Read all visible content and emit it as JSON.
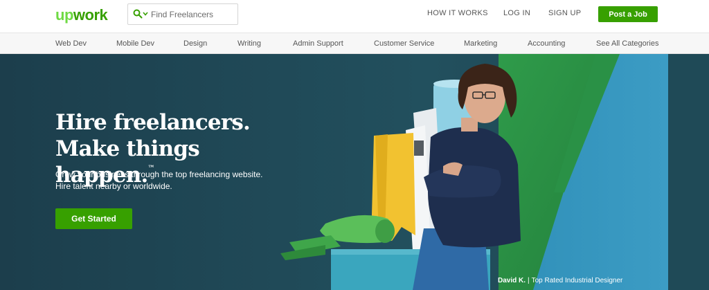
{
  "header": {
    "logo_up": "up",
    "logo_work": "work",
    "search_placeholder": "Find Freelancers",
    "nav": {
      "how_it_works": "HOW IT WORKS",
      "login": "LOG IN",
      "signup": "SIGN UP"
    },
    "post_job": "Post a Job"
  },
  "categories": [
    "Web Dev",
    "Mobile Dev",
    "Design",
    "Writing",
    "Admin Support",
    "Customer Service",
    "Marketing",
    "Accounting",
    "See All Categories"
  ],
  "hero": {
    "headline_line1": "Hire freelancers.",
    "headline_line2": "Make things happen.",
    "trademark": "™",
    "subtext": "Grow your business through the top freelancing website. Hire talent nearby or worldwide.",
    "cta": "Get Started",
    "caption_name": "David K.",
    "caption_sep": "|",
    "caption_title": "Top Rated Industrial Designer"
  },
  "colors": {
    "brand_green": "#37a000",
    "logo_light_green": "#6fda44",
    "hero_bg": "#1f4654"
  }
}
